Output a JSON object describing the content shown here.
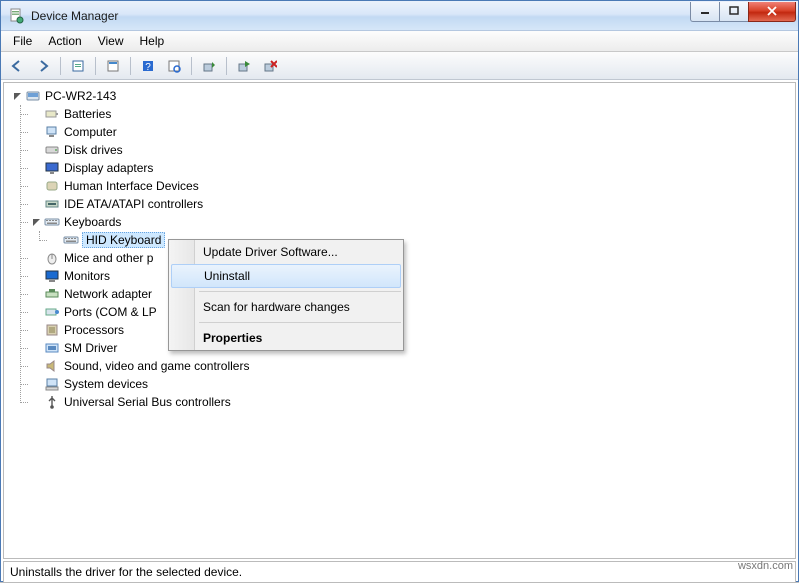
{
  "window_title": "Device Manager",
  "menubar": [
    "File",
    "Action",
    "View",
    "Help"
  ],
  "toolbar": [
    {
      "name": "back-icon"
    },
    {
      "name": "forward-icon"
    },
    {
      "sep": true
    },
    {
      "name": "show-hidden-icon"
    },
    {
      "sep": true
    },
    {
      "name": "properties-icon"
    },
    {
      "sep": true
    },
    {
      "name": "help-icon"
    },
    {
      "name": "scan-icon"
    },
    {
      "sep": true
    },
    {
      "name": "update-driver-icon"
    },
    {
      "sep": true
    },
    {
      "name": "uninstall-icon"
    },
    {
      "name": "disable-icon"
    }
  ],
  "root": {
    "label": "PC-WR2-143",
    "children": [
      {
        "label": "Batteries",
        "icon": "battery"
      },
      {
        "label": "Computer",
        "icon": "computer"
      },
      {
        "label": "Disk drives",
        "icon": "disk"
      },
      {
        "label": "Display adapters",
        "icon": "display"
      },
      {
        "label": "Human Interface Devices",
        "icon": "hid"
      },
      {
        "label": "IDE ATA/ATAPI controllers",
        "icon": "ide"
      },
      {
        "label": "Keyboards",
        "icon": "keyboard",
        "expanded": true,
        "children": [
          {
            "label": "HID Keyboard",
            "icon": "keyboard",
            "selected": true
          }
        ]
      },
      {
        "label": "Mice and other p",
        "icon": "mouse"
      },
      {
        "label": "Monitors",
        "icon": "monitor"
      },
      {
        "label": "Network adapter",
        "icon": "network"
      },
      {
        "label": "Ports (COM & LP",
        "icon": "port"
      },
      {
        "label": "Processors",
        "icon": "processor"
      },
      {
        "label": "SM Driver",
        "icon": "sm"
      },
      {
        "label": "Sound, video and game controllers",
        "icon": "sound"
      },
      {
        "label": "System devices",
        "icon": "system"
      },
      {
        "label": "Universal Serial Bus controllers",
        "icon": "usb"
      }
    ]
  },
  "context_menu": {
    "items": [
      {
        "label": "Update Driver Software..."
      },
      {
        "label": "Uninstall",
        "highlight": true
      },
      {
        "sep": true
      },
      {
        "label": "Scan for hardware changes"
      },
      {
        "sep": true
      },
      {
        "label": "Properties",
        "bold": true
      }
    ]
  },
  "statusbar": "Uninstalls the driver for the selected device.",
  "watermark": "wsxdn.com"
}
